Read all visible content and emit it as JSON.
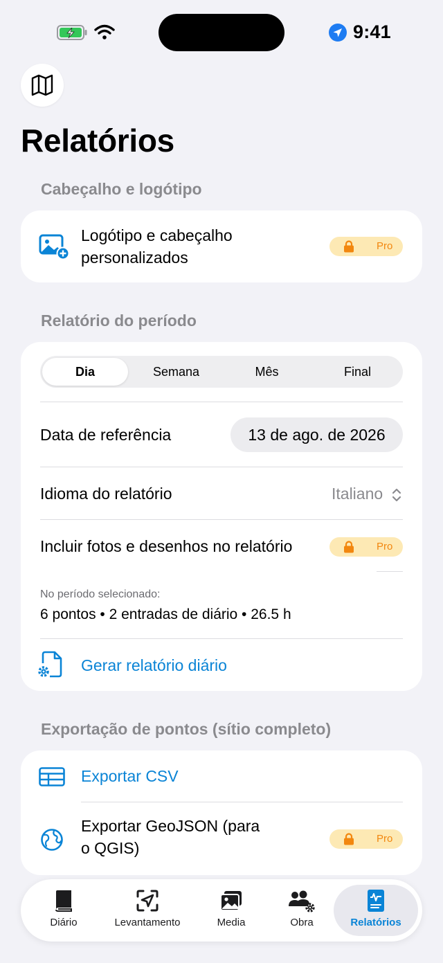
{
  "status": {
    "time": "9:41"
  },
  "page": {
    "title": "Relatórios"
  },
  "header_section": {
    "heading": "Cabeçalho e logótipo",
    "item_line1": "Logótipo e cabeçalho",
    "item_line2": "personalizados",
    "badge": "Pro"
  },
  "period_section": {
    "heading": "Relatório do período",
    "tabs": [
      "Dia",
      "Semana",
      "Mês",
      "Final"
    ],
    "selected_tab": "Dia",
    "reference_label": "Data de referência",
    "reference_value": "13 de ago. de 2026",
    "language_label": "Idioma do relatório",
    "language_value": "Italiano",
    "photos_label": "Incluir fotos e desenhos no relatório",
    "photos_badge": "Pro",
    "summary_caption": "No período selecionado:",
    "summary_value": "6 pontos • 2 entradas de diário • 26.5 h",
    "generate_label": "Gerar relatório diário"
  },
  "export_section": {
    "heading": "Exportação de pontos (sítio completo)",
    "csv_label": "Exportar CSV",
    "geojson_line1": "Exportar GeoJSON (para",
    "geojson_line2": "o QGIS)",
    "geojson_badge": "Pro"
  },
  "tabbar": {
    "items": [
      "Diário",
      "Levantamento",
      "Media",
      "Obra",
      "Relatórios"
    ],
    "active": "Relatórios"
  },
  "colors": {
    "accent": "#0a84d6",
    "pro_bg": "#fde9b4",
    "pro_text": "#f2870f",
    "background": "#f2f2f7"
  }
}
